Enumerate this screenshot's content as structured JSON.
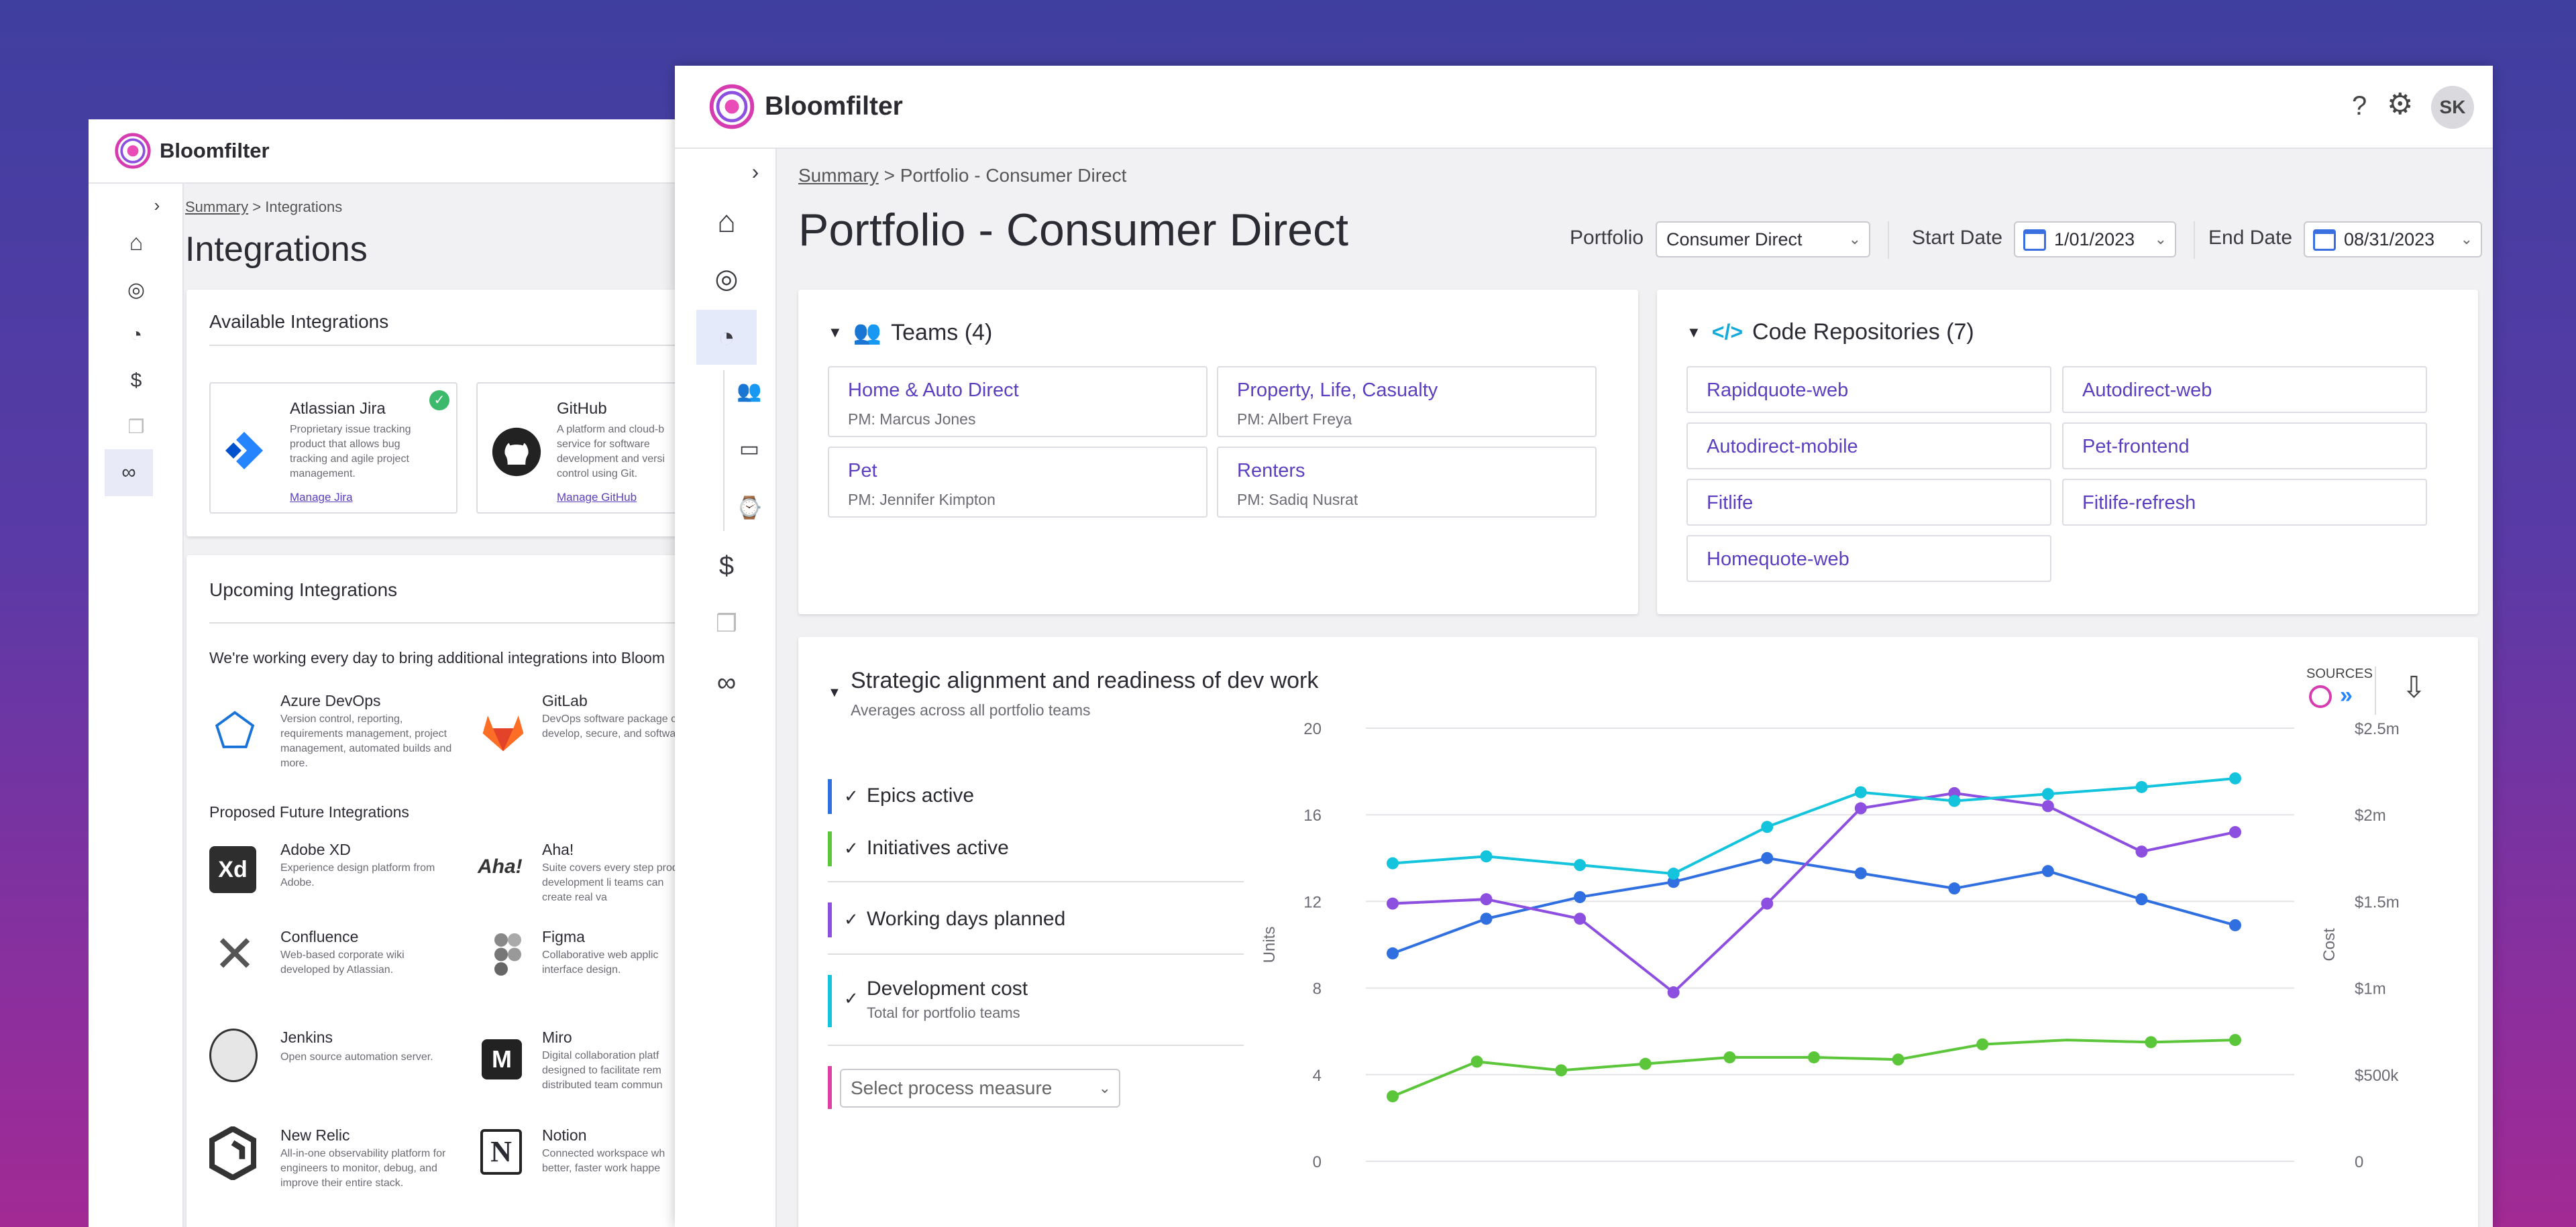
{
  "app_name": "Bloomfilter",
  "back": {
    "breadcrumb_link": "Summary",
    "breadcrumb_sep": ">",
    "breadcrumb_current": "Integrations",
    "page_title": "Integrations",
    "available_title": "Available Integrations",
    "available": [
      {
        "name": "Atlassian Jira",
        "desc": "Proprietary issue tracking product that allows bug tracking and agile project management.",
        "link": "Manage Jira"
      },
      {
        "name": "GitHub",
        "desc": "A platform and cloud-b service for software development and versi control using Git.",
        "link": "Manage GitHub"
      }
    ],
    "upcoming_title": "Upcoming Integrations",
    "upcoming_intro": "We're working every day to bring additional integrations into Bloom",
    "upcoming": [
      {
        "name": "Azure DevOps",
        "desc": "Version control, reporting, requirements management, project management, automated builds and more."
      },
      {
        "name": "GitLab",
        "desc": "DevOps software package can develop, secure, and software."
      }
    ],
    "proposed_title": "Proposed Future Integrations",
    "proposed": [
      {
        "name": "Adobe XD",
        "desc": "Experience design platform from Adobe.",
        "logo": "Xd"
      },
      {
        "name": "Aha!",
        "desc": "Suite covers every step product development li teams can create real va",
        "logo": "Aha!"
      },
      {
        "name": "Confluence",
        "desc": "Web-based corporate wiki developed by Atlassian.",
        "logo": ""
      },
      {
        "name": "Figma",
        "desc": "Collaborative web applic interface design.",
        "logo": ""
      },
      {
        "name": "Jenkins",
        "desc": "Open source automation server.",
        "logo": ""
      },
      {
        "name": "Miro",
        "desc": "Digital collaboration platf designed to facilitate rem distributed team commun",
        "logo": ""
      },
      {
        "name": "New Relic",
        "desc": "All-in-one observability platform for engineers to monitor, debug, and improve their entire stack.",
        "logo": ""
      },
      {
        "name": "Notion",
        "desc": "Connected workspace wh better, faster work happe",
        "logo": "N"
      }
    ]
  },
  "front": {
    "help": "?",
    "avatar": "SK",
    "breadcrumb_link": "Summary",
    "breadcrumb_sep": ">",
    "breadcrumb_current": "Portfolio - Consumer Direct",
    "page_title": "Portfolio - Consumer Direct",
    "filters": {
      "portfolio_label": "Portfolio",
      "portfolio_value": "Consumer Direct",
      "start_label": "Start Date",
      "start_value": "1/01/2023",
      "end_label": "End Date",
      "end_value": "08/31/2023"
    },
    "teams": {
      "title": "Teams (4)",
      "items": [
        {
          "name": "Home & Auto Direct",
          "pm": "PM: Marcus Jones"
        },
        {
          "name": "Property, Life, Casualty",
          "pm": "PM: Albert Freya"
        },
        {
          "name": "Pet",
          "pm": "PM: Jennifer Kimpton"
        },
        {
          "name": "Renters",
          "pm": "PM: Sadiq Nusrat"
        }
      ]
    },
    "repos": {
      "title": "Code Repositories (7)",
      "items": [
        "Rapidquote-web",
        "Autodirect-web",
        "Autodirect-mobile",
        "Pet-frontend",
        "Fitlife",
        "Fitlife-refresh",
        "Homequote-web"
      ]
    },
    "strategic": {
      "title": "Strategic alignment and readiness of dev work",
      "subtitle": "Averages across all portfolio teams",
      "sources_label": "SOURCES",
      "metrics": [
        {
          "label": "Epics active",
          "sub": "",
          "check": "✓"
        },
        {
          "label": "Initiatives active",
          "sub": "",
          "check": "✓"
        },
        {
          "label": "Working days planned",
          "sub": "",
          "check": "✓"
        },
        {
          "label": "Development cost",
          "sub": "Total for portfolio teams",
          "check": "✓"
        }
      ],
      "select_placeholder": "Select process measure"
    }
  },
  "colors": {
    "epics": "#2f6fe0",
    "initiatives": "#5cc63a",
    "working_days": "#8d4fe0",
    "cost": "#14c4dc",
    "process": "#e040a0",
    "accent": "#5b3fc0"
  },
  "chart_data": {
    "type": "line",
    "ylabel": "Units",
    "y2label": "Cost",
    "ylim": [
      0,
      20
    ],
    "y_ticks": [
      "0",
      "4",
      "8",
      "12",
      "16",
      "20"
    ],
    "y2lim": [
      0,
      2500000
    ],
    "y2_ticks": [
      "0",
      "$500k",
      "$1m",
      "$1.5m",
      "$2m",
      "$2.5m"
    ],
    "grid": true,
    "series": [
      {
        "name": "Epics active",
        "axis": "left",
        "values": [
          9.6,
          11.2,
          12.2,
          12.9,
          14.0,
          13.3,
          12.6,
          13.4,
          12.1,
          10.9
        ],
        "points": [
          true,
          true,
          true,
          true,
          true,
          true,
          true,
          true,
          true,
          true
        ]
      },
      {
        "name": "Initiatives active",
        "axis": "left",
        "values": [
          3.0,
          4.6,
          4.2,
          4.5,
          4.8,
          4.8,
          4.7,
          5.4,
          5.6,
          5.5,
          5.6
        ],
        "points": [
          true,
          true,
          true,
          true,
          true,
          true,
          true,
          true,
          false,
          true,
          true
        ]
      },
      {
        "name": "Working days planned",
        "axis": "left",
        "values": [
          11.9,
          12.1,
          11.2,
          7.8,
          11.9,
          16.3,
          17.0,
          16.4,
          14.3,
          15.2
        ],
        "points": [
          true,
          true,
          true,
          true,
          true,
          true,
          true,
          true,
          true,
          true
        ]
      },
      {
        "name": "Development cost",
        "axis": "right",
        "values": [
          1720000,
          1760000,
          1710000,
          1660000,
          1930000,
          2130000,
          2080000,
          2120000,
          2160000,
          2210000
        ],
        "points": [
          true,
          true,
          true,
          true,
          true,
          true,
          true,
          true,
          true,
          true
        ]
      }
    ]
  }
}
